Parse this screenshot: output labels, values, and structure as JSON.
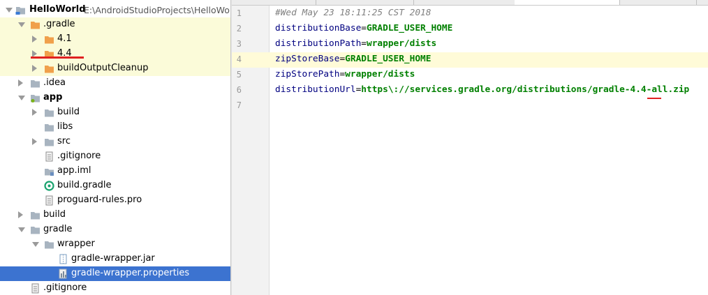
{
  "project_tree": {
    "rows": [
      {
        "label": "HelloWorld",
        "path": "E:\\AndroidStudioProjects\\HelloWorld",
        "icon": "module-folder-icon",
        "indent": 0,
        "arrow": "down"
      },
      {
        "label": ".gradle",
        "icon": "folder-orange-icon",
        "indent": 1,
        "arrow": "down"
      },
      {
        "label": "4.1",
        "icon": "folder-orange-icon",
        "indent": 2,
        "arrow": "right"
      },
      {
        "label": "4.4",
        "icon": "folder-orange-icon",
        "indent": 2,
        "arrow": "right"
      },
      {
        "label": "buildOutputCleanup",
        "icon": "folder-orange-icon",
        "indent": 2,
        "arrow": "right"
      },
      {
        "label": ".idea",
        "icon": "folder-icon",
        "indent": 1,
        "arrow": "right"
      },
      {
        "label": "app",
        "icon": "module-folder-icon",
        "indent": 1,
        "arrow": "down"
      },
      {
        "label": "build",
        "icon": "folder-icon",
        "indent": 2,
        "arrow": "right"
      },
      {
        "label": "libs",
        "icon": "folder-icon",
        "indent": 2,
        "arrow": "none"
      },
      {
        "label": "src",
        "icon": "folder-icon",
        "indent": 2,
        "arrow": "right"
      },
      {
        "label": ".gitignore",
        "icon": "text-file-icon",
        "indent": 2,
        "arrow": "none"
      },
      {
        "label": "app.iml",
        "icon": "iml-file-icon",
        "indent": 2,
        "arrow": "none"
      },
      {
        "label": "build.gradle",
        "icon": "gradle-file-icon",
        "indent": 2,
        "arrow": "none"
      },
      {
        "label": "proguard-rules.pro",
        "icon": "text-file-icon",
        "indent": 2,
        "arrow": "none"
      },
      {
        "label": "build",
        "icon": "folder-icon",
        "indent": 1,
        "arrow": "right"
      },
      {
        "label": "gradle",
        "icon": "folder-icon",
        "indent": 1,
        "arrow": "down"
      },
      {
        "label": "wrapper",
        "icon": "folder-icon",
        "indent": 2,
        "arrow": "down"
      },
      {
        "label": "gradle-wrapper.jar",
        "icon": "jar-file-icon",
        "indent": 3,
        "arrow": "none"
      },
      {
        "label": "gradle-wrapper.properties",
        "icon": "properties-file-icon",
        "indent": 3,
        "arrow": "none"
      },
      {
        "label": ".gitignore",
        "icon": "text-file-icon",
        "indent": 1,
        "arrow": "none"
      }
    ]
  },
  "editor": {
    "lines": [
      {
        "num": "1",
        "comment": "#Wed May 23 18:11:25 CST 2018"
      },
      {
        "num": "2",
        "key": "distributionBase",
        "value": "GRADLE_USER_HOME"
      },
      {
        "num": "3",
        "key": "distributionPath",
        "value": "wrapper/dists"
      },
      {
        "num": "4",
        "key": "zipStoreBase",
        "value": "GRADLE_USER_HOME"
      },
      {
        "num": "5",
        "key": "zipStorePath",
        "value": "wrapper/dists"
      },
      {
        "num": "6",
        "key": "distributionUrl",
        "value": "https\\://services.gradle.org/distributions/gradle-4.4-all.zip"
      },
      {
        "num": "7"
      }
    ],
    "equals": "="
  },
  "colors": {
    "selection": "#3c73d0",
    "highlight_row": "#fbfbd9",
    "folder_orange": "#f0a04b",
    "folder_gray": "#a8b4c0",
    "annotation_red": "#e02020",
    "key_color": "#000080",
    "value_color": "#008000",
    "comment_color": "#808080"
  }
}
